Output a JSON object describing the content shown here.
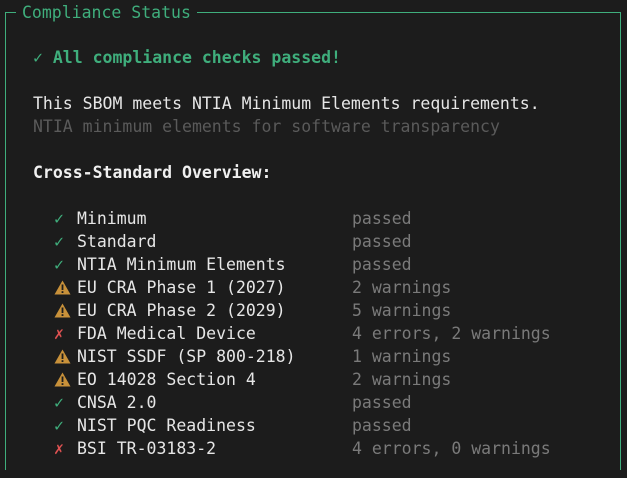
{
  "panel": {
    "title": "Compliance Status",
    "border_color": "#3fae7c"
  },
  "summary": {
    "success_text": "✓ All compliance checks passed!",
    "meets_text": "This SBOM meets NTIA Minimum Elements requirements.",
    "description": "NTIA minimum elements for software transparency"
  },
  "overview": {
    "heading": "Cross-Standard Overview:",
    "standards": [
      {
        "icon": "check-icon",
        "glyph": "✓",
        "kind": "ok",
        "name": "Minimum",
        "status": "passed"
      },
      {
        "icon": "check-icon",
        "glyph": "✓",
        "kind": "ok",
        "name": "Standard",
        "status": "passed"
      },
      {
        "icon": "check-icon",
        "glyph": "✓",
        "kind": "ok",
        "name": "NTIA Minimum Elements",
        "status": "passed"
      },
      {
        "icon": "warning-icon",
        "glyph": "",
        "kind": "warn",
        "name": "EU CRA Phase 1 (2027)",
        "status": "2 warnings"
      },
      {
        "icon": "warning-icon",
        "glyph": "",
        "kind": "warn",
        "name": "EU CRA Phase 2 (2029)",
        "status": "5 warnings"
      },
      {
        "icon": "cross-icon",
        "glyph": "✗",
        "kind": "err",
        "name": "FDA Medical Device",
        "status": "4 errors, 2 warnings"
      },
      {
        "icon": "warning-icon",
        "glyph": "",
        "kind": "warn",
        "name": "NIST SSDF (SP 800-218)",
        "status": "1 warnings"
      },
      {
        "icon": "warning-icon",
        "glyph": "",
        "kind": "warn",
        "name": "EO 14028 Section 4",
        "status": "2 warnings"
      },
      {
        "icon": "check-icon",
        "glyph": "✓",
        "kind": "ok",
        "name": "CNSA 2.0",
        "status": "passed"
      },
      {
        "icon": "check-icon",
        "glyph": "✓",
        "kind": "ok",
        "name": "NIST PQC Readiness",
        "status": "passed"
      },
      {
        "icon": "cross-icon",
        "glyph": "✗",
        "kind": "err",
        "name": "BSI TR-03183-2",
        "status": "4 errors, 0 warnings"
      }
    ]
  },
  "colors": {
    "ok": "#3fae7c",
    "warn": "#c8913a",
    "err": "#e05252",
    "muted": "#7a7a7a"
  }
}
